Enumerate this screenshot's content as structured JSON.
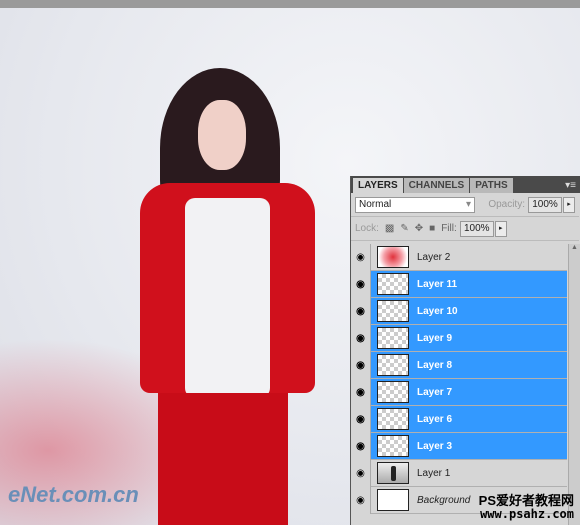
{
  "layers_panel": {
    "tabs": [
      {
        "label": "LAYERS",
        "active": true
      },
      {
        "label": "CHANNELS",
        "active": false
      },
      {
        "label": "PATHS",
        "active": false
      }
    ],
    "blend_mode": "Normal",
    "opacity_label": "Opacity:",
    "opacity": "100%",
    "lock_label": "Lock:",
    "fill_label": "Fill:",
    "fill": "100%",
    "layers": [
      {
        "name": "Layer 2",
        "selected": false,
        "thumb": "red"
      },
      {
        "name": "Layer 11",
        "selected": true,
        "thumb": "transparent"
      },
      {
        "name": "Layer 10",
        "selected": true,
        "thumb": "transparent"
      },
      {
        "name": "Layer 9",
        "selected": true,
        "thumb": "transparent"
      },
      {
        "name": "Layer 8",
        "selected": true,
        "thumb": "transparent"
      },
      {
        "name": "Layer 7",
        "selected": true,
        "thumb": "transparent"
      },
      {
        "name": "Layer 6",
        "selected": true,
        "thumb": "transparent"
      },
      {
        "name": "Layer 3",
        "selected": true,
        "thumb": "transparent"
      },
      {
        "name": "Layer 1",
        "selected": false,
        "thumb": "photo"
      },
      {
        "name": "Background",
        "selected": false,
        "thumb": "white"
      }
    ],
    "selection_color": "#3399ff"
  },
  "watermarks": {
    "left": "eNet.com.cn",
    "right_line1": "PS爱好者教程网",
    "right_line2": "www.psahz.com"
  }
}
